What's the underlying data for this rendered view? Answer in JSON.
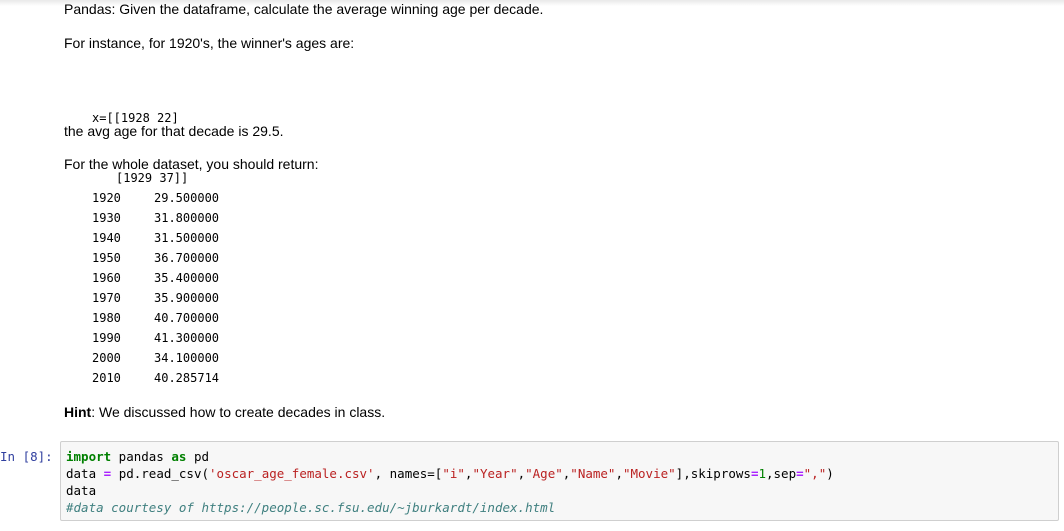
{
  "markdown": {
    "title_line": "Pandas: Given the dataframe, calculate the average winning age per decade.",
    "instance_line": "For instance, for 1920's, the winner's ages are:",
    "x_line1": "x=[[1928 22]",
    "x_line2": "[1929 37]]",
    "avg_line": "the avg age for that decade is 29.5.",
    "whole_line": "For the whole dataset, you should return:",
    "decades": [
      {
        "decade": "1920",
        "avg": "29.500000"
      },
      {
        "decade": "1930",
        "avg": "31.800000"
      },
      {
        "decade": "1940",
        "avg": "31.500000"
      },
      {
        "decade": "1950",
        "avg": "36.700000"
      },
      {
        "decade": "1960",
        "avg": "35.400000"
      },
      {
        "decade": "1970",
        "avg": "35.900000"
      },
      {
        "decade": "1980",
        "avg": "40.700000"
      },
      {
        "decade": "1990",
        "avg": "41.300000"
      },
      {
        "decade": "2000",
        "avg": "34.100000"
      },
      {
        "decade": "2010",
        "avg": "40.285714"
      }
    ],
    "hint_label": "Hint",
    "hint_text": ": We discussed how to create decades in class."
  },
  "cell": {
    "prompt": "In [8]:",
    "line1": {
      "kw1": "import",
      "mod": " pandas ",
      "kw2": "as",
      "alias": " pd"
    },
    "line2": {
      "lhs": "data ",
      "eq": "=",
      "call": " pd.read_csv(",
      "file": "'oscar_age_female.csv'",
      "names_kw": ", names=[",
      "n1": "\"i\"",
      "n2": "\"Year\"",
      "n3": "\"Age\"",
      "n4": "\"Name\"",
      "n5": "\"Movie\"",
      "skip_kw": "],skiprows",
      "eq2": "=",
      "skip_val": "1",
      "sep_kw": ",sep",
      "eq3": "=",
      "sep_val": "\",\"",
      "close": ")"
    },
    "line3": "data",
    "line4": "#data courtesy of https://people.sc.fsu.edu/~jburkardt/index.html"
  }
}
